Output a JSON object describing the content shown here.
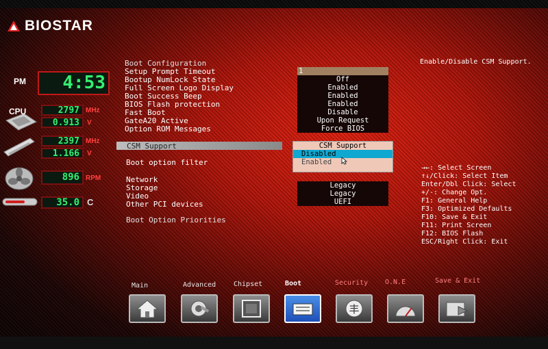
{
  "brand": "BIOSTAR",
  "monitor": {
    "clock_ampm": "PM",
    "clock_time": "4:53",
    "cpu_label": "CPU",
    "cpu_freq": "2797",
    "cpu_freq_unit": "MHz",
    "cpu_volt": "0.913",
    "volt_unit": "V",
    "mem_freq": "2397",
    "mem_freq_unit": "MHz",
    "mem_volt": "1.166",
    "fan_rpm": "896",
    "rpm_unit": "RPM",
    "temp": "35.0",
    "temp_unit": "C"
  },
  "section_title": "Boot Configuration",
  "settings": [
    {
      "label": "Setup Prompt Timeout",
      "value": "1"
    },
    {
      "label": "Bootup NumLock State",
      "value": "Off"
    },
    {
      "label": "Full Screen Logo Display",
      "value": "Enabled"
    },
    {
      "label": "Boot Success Beep",
      "value": "Enabled"
    },
    {
      "label": "BIOS Flash protection",
      "value": "Enabled"
    },
    {
      "label": "Fast Boot",
      "value": "Disable"
    },
    {
      "label": "GateA20 Active",
      "value": "Upon Request"
    },
    {
      "label": "Option ROM Messages",
      "value": "Force BIOS"
    }
  ],
  "csm_label": "CSM Support",
  "boot_filter_label": "Boot option filter",
  "devices": [
    {
      "label": "Network",
      "value": ""
    },
    {
      "label": "Storage",
      "value": "Legacy"
    },
    {
      "label": "Video",
      "value": "Legacy"
    },
    {
      "label": "Other PCI devices",
      "value": "UEFI"
    }
  ],
  "boot_priorities": "Boot Option Priorities",
  "popup": {
    "title": "CSM Support",
    "options": [
      "Disabled",
      "Enabled"
    ]
  },
  "help_description": "Enable/Disable CSM Support.",
  "help_keys": [
    "→←: Select Screen",
    "↑↓/Click: Select Item",
    "Enter/Dbl Click: Select",
    "+/-: Change Opt.",
    "F1: General Help",
    "F3: Optimized Defaults",
    "F10: Save & Exit",
    "F11: Print Screen",
    "F12: BIOS Flash",
    "ESC/Right Click: Exit"
  ],
  "tabs": [
    {
      "label": "Main",
      "icon": "home-icon"
    },
    {
      "label": "Advanced",
      "icon": "settings-icon"
    },
    {
      "label": "Chipset",
      "icon": "chip-icon"
    },
    {
      "label": "Boot",
      "icon": "drive-icon"
    },
    {
      "label": "Security",
      "icon": "shield-icon"
    },
    {
      "label": "O.N.E",
      "icon": "gauge-icon"
    },
    {
      "label": "Save & Exit",
      "icon": "folder-exit-icon"
    }
  ],
  "colors": {
    "accent": "#e0200f",
    "lcd_text": "#35f070",
    "highlight": "#10a8d0"
  }
}
